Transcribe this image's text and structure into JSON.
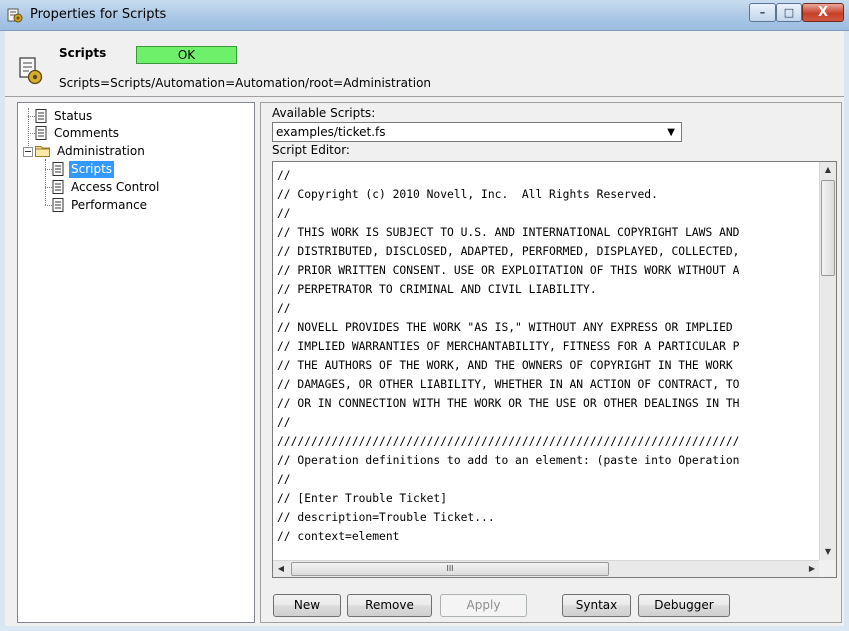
{
  "window": {
    "title": "Properties for Scripts",
    "controls": {
      "minimize": "–",
      "maximize": "□",
      "close": "X"
    }
  },
  "header": {
    "name": "Scripts",
    "status": "OK",
    "status_color": "#6ef06a",
    "path": "Scripts=Scripts/Automation=Automation/root=Administration"
  },
  "tree": {
    "items": [
      {
        "label": "Status",
        "icon": "document-icon"
      },
      {
        "label": "Comments",
        "icon": "document-icon"
      },
      {
        "label": "Administration",
        "icon": "folder-icon"
      },
      {
        "label": "Scripts",
        "icon": "document-icon",
        "selected": true
      },
      {
        "label": "Access Control",
        "icon": "document-icon"
      },
      {
        "label": "Performance",
        "icon": "document-icon"
      }
    ]
  },
  "panel": {
    "available_label": "Available Scripts:",
    "selected_script": "examples/ticket.fs",
    "editor_label": "Script Editor:",
    "code_lines": [
      "//",
      "// Copyright (c) 2010 Novell, Inc.  All Rights Reserved.",
      "//",
      "// THIS WORK IS SUBJECT TO U.S. AND INTERNATIONAL COPYRIGHT LAWS AND",
      "// DISTRIBUTED, DISCLOSED, ADAPTED, PERFORMED, DISPLAYED, COLLECTED,",
      "// PRIOR WRITTEN CONSENT. USE OR EXPLOITATION OF THIS WORK WITHOUT A",
      "// PERPETRATOR TO CRIMINAL AND CIVIL LIABILITY.",
      "//",
      "// NOVELL PROVIDES THE WORK \"AS IS,\" WITHOUT ANY EXPRESS OR IMPLIED",
      "// IMPLIED WARRANTIES OF MERCHANTABILITY, FITNESS FOR A PARTICULAR P",
      "// THE AUTHORS OF THE WORK, AND THE OWNERS OF COPYRIGHT IN THE WORK",
      "// DAMAGES, OR OTHER LIABILITY, WHETHER IN AN ACTION OF CONTRACT, TO",
      "// OR IN CONNECTION WITH THE WORK OR THE USE OR OTHER DEALINGS IN TH",
      "//",
      "////////////////////////////////////////////////////////////////////",
      "// Operation definitions to add to an element: (paste into Operation",
      "//",
      "// [Enter Trouble Ticket]",
      "// description=Trouble Ticket...",
      "// context=element"
    ],
    "hscroll_grip": "III",
    "buttons": {
      "new": "New",
      "remove": "Remove",
      "apply": "Apply",
      "syntax": "Syntax",
      "debugger": "Debugger"
    }
  }
}
